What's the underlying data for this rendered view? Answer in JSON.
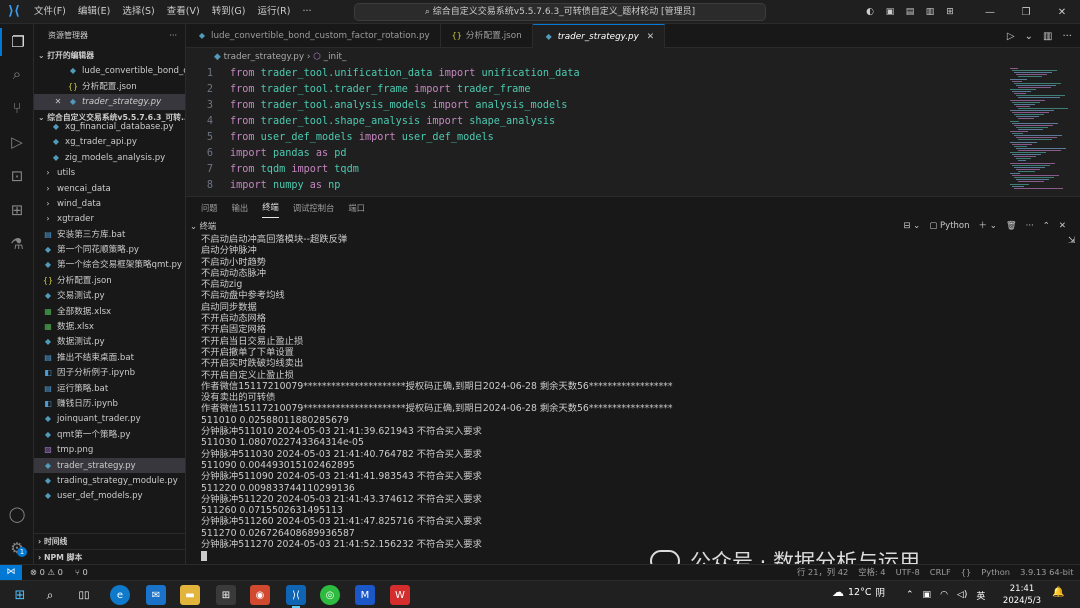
{
  "menu": [
    "文件(F)",
    "编辑(E)",
    "选择(S)",
    "查看(V)",
    "转到(G)",
    "运行(R)",
    "···"
  ],
  "command_center": "综合自定义交易系统v5.5.7.6.3_可转债自定义_题材轮动 [管理员]",
  "sidebar": {
    "title": "资源管理器",
    "open_editors_label": "打开的编辑器",
    "open_editors": [
      {
        "name": "lude_convertible_bond_c...",
        "icon": "py-icon",
        "selected": false,
        "close": false
      },
      {
        "name": "分析配置.json",
        "icon": "json-icon",
        "selected": false,
        "close": false
      },
      {
        "name": "trader_strategy.py",
        "icon": "py-icon",
        "selected": true,
        "close": true
      }
    ],
    "workspace_label": "综合自定义交易系统v5.5.7.6.3_可转...",
    "files": [
      {
        "name": "xg_financial_database.py",
        "icon": "py-icon",
        "indent": 1
      },
      {
        "name": "xg_trader_api.py",
        "icon": "py-icon",
        "indent": 1
      },
      {
        "name": "zig_models_analysis.py",
        "icon": "py-icon",
        "indent": 1
      },
      {
        "name": "utils",
        "icon": "folder-icon",
        "indent": 0
      },
      {
        "name": "wencai_data",
        "icon": "folder-icon",
        "indent": 0
      },
      {
        "name": "wind_data",
        "icon": "folder-icon",
        "indent": 0
      },
      {
        "name": "xgtrader",
        "icon": "folder-icon",
        "indent": 0
      },
      {
        "name": "安装第三方库.bat",
        "icon": "bat-icon",
        "indent": 0
      },
      {
        "name": "第一个同花顺策略.py",
        "icon": "py-icon",
        "indent": 0
      },
      {
        "name": "第一个综合交易框架策略qmt.py",
        "icon": "py-icon",
        "indent": 0
      },
      {
        "name": "分析配置.json",
        "icon": "json-icon",
        "indent": 0
      },
      {
        "name": "交易测试.py",
        "icon": "py-icon",
        "indent": 0
      },
      {
        "name": "全部数据.xlsx",
        "icon": "xlsx-icon",
        "indent": 0
      },
      {
        "name": "数据.xlsx",
        "icon": "xlsx-icon",
        "indent": 0
      },
      {
        "name": "数据测试.py",
        "icon": "py-icon",
        "indent": 0
      },
      {
        "name": "推出不结束桌面.bat",
        "icon": "bat-icon",
        "indent": 0
      },
      {
        "name": "因子分析例子.ipynb",
        "icon": "ipynb-icon",
        "indent": 0
      },
      {
        "name": "运行策略.bat",
        "icon": "bat-icon",
        "indent": 0
      },
      {
        "name": "赚钱日历.ipynb",
        "icon": "ipynb-icon",
        "indent": 0
      },
      {
        "name": "joinquant_trader.py",
        "icon": "py-icon",
        "indent": 0
      },
      {
        "name": "qmt第一个策略.py",
        "icon": "py-icon",
        "indent": 0
      },
      {
        "name": "tmp.png",
        "icon": "png-icon",
        "indent": 0
      },
      {
        "name": "trader_strategy.py",
        "icon": "py-icon",
        "indent": 0,
        "selected": true
      },
      {
        "name": "trading_strategy_module.py",
        "icon": "py-icon",
        "indent": 0
      },
      {
        "name": "user_def_models.py",
        "icon": "py-icon",
        "indent": 0
      }
    ],
    "timeline_label": "时间线",
    "npm_label": "NPM 脚本"
  },
  "tabs": [
    {
      "label": "lude_convertible_bond_custom_factor_rotation.py",
      "icon": "py-icon",
      "active": false
    },
    {
      "label": "分析配置.json",
      "icon": "json-icon",
      "active": false
    },
    {
      "label": "trader_strategy.py",
      "icon": "py-icon",
      "active": true
    }
  ],
  "breadcrumb": {
    "file": "trader_strategy.py",
    "symbol": "_init_"
  },
  "code": [
    {
      "n": "1",
      "parts": [
        [
          "kw",
          "from "
        ],
        [
          "mod",
          "trader_tool.unification_data"
        ],
        [
          "kw",
          " import "
        ],
        [
          "mod",
          "unification_data"
        ]
      ]
    },
    {
      "n": "2",
      "parts": [
        [
          "kw",
          "from "
        ],
        [
          "mod",
          "trader_tool.trader_frame"
        ],
        [
          "kw",
          " import "
        ],
        [
          "mod",
          "trader_frame"
        ]
      ]
    },
    {
      "n": "3",
      "parts": [
        [
          "kw",
          "from "
        ],
        [
          "mod",
          "trader_tool.analysis_models"
        ],
        [
          "kw",
          " import "
        ],
        [
          "mod",
          "analysis_models"
        ]
      ]
    },
    {
      "n": "4",
      "parts": [
        [
          "kw",
          "from "
        ],
        [
          "mod",
          "trader_tool.shape_analysis"
        ],
        [
          "kw",
          " import "
        ],
        [
          "mod",
          "shape_analysis"
        ]
      ]
    },
    {
      "n": "5",
      "parts": [
        [
          "kw",
          "from "
        ],
        [
          "mod",
          "user_def_models"
        ],
        [
          "kw",
          " import "
        ],
        [
          "mod",
          "user_def_models"
        ]
      ]
    },
    {
      "n": "6",
      "parts": [
        [
          "kw",
          "import "
        ],
        [
          "mod",
          "pandas"
        ],
        [
          "kw",
          " as "
        ],
        [
          "mod",
          "pd"
        ]
      ]
    },
    {
      "n": "7",
      "parts": [
        [
          "kw",
          "from "
        ],
        [
          "mod",
          "tqdm"
        ],
        [
          "kw",
          " import "
        ],
        [
          "mod",
          "tqdm"
        ]
      ]
    },
    {
      "n": "8",
      "parts": [
        [
          "kw",
          "import "
        ],
        [
          "mod",
          "numpy"
        ],
        [
          "kw",
          " as "
        ],
        [
          "mod",
          "np"
        ]
      ]
    }
  ],
  "panel_tabs": [
    "问题",
    "输出",
    "终端",
    "调试控制台",
    "端口"
  ],
  "terminal_label": "终端",
  "terminal_shell": "Python",
  "terminal_lines": [
    "不启动启动冲高回落模块--超跌反弹",
    "启动分钟脉冲",
    "不启动小时趋势",
    "不启动动态脉冲",
    "不启动zig",
    "不启动盘中参考均线",
    "启动同步数据",
    "不开启动态网格",
    "不开启固定网格",
    "不开启当日交易止盈止损",
    "不开启撤单了下单设置",
    "不开启实时跌破均线卖出",
    "不开启自定义止盈止损",
    "作者微信15117210079**********************授权码正确,到期日2024-06-28 剩余天数56******************",
    "没有卖出的可转债",
    "作者微信15117210079**********************授权码正确,到期日2024-06-28 剩余天数56******************",
    "511010 0.02588011880285679",
    "分钟脉冲511010 2024-05-03 21:41:39.621943 不符合买入要求",
    "511030 1.0807022743364314e-05",
    "分钟脉冲511030 2024-05-03 21:41:40.764782 不符合买入要求",
    "511090 0.004493015102462895",
    "分钟脉冲511090 2024-05-03 21:41:41.983543 不符合买入要求",
    "511220 0.009833744110299136",
    "分钟脉冲511220 2024-05-03 21:41:43.374612 不符合买入要求",
    "511260 0.0715502631495113",
    "分钟脉冲511260 2024-05-03 21:41:47.825716 不符合买入要求",
    "511270 0.026726408689936587",
    "分钟脉冲511270 2024-05-03 21:41:52.156232 不符合买入要求"
  ],
  "watermark": "公众号 · 数据分析与运用",
  "status": {
    "errors": "⊗ 0 ⚠ 0",
    "ports": "⑂ 0",
    "position": "行 21，列 42",
    "spaces": "空格: 4",
    "encoding": "UTF-8",
    "eol": "CRLF",
    "language": "Python",
    "interp": "3.9.13 64-bit"
  },
  "taskbar": {
    "weather_temp": "12°C",
    "weather_desc": "阴",
    "ime": "英",
    "time": "21:41",
    "date": "2024/5/3"
  }
}
